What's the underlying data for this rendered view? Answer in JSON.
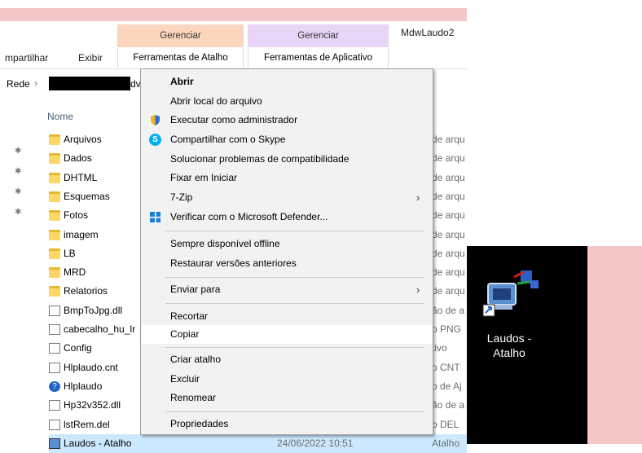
{
  "ribbon": {
    "tabs": [
      "mpartilhar",
      "Exibir"
    ],
    "ctx_groups": [
      {
        "header": "Gerenciar",
        "label": "Ferramentas de Atalho",
        "color": "#fcd5bd"
      },
      {
        "header": "Gerenciar",
        "label": "Ferramentas de Aplicativo",
        "color": "#e8d5f7"
      }
    ],
    "window_title": "MdwLaudo2"
  },
  "address": {
    "root": "Rede",
    "sep": "›",
    "partial": "dv"
  },
  "list": {
    "header": "Nome",
    "items": [
      {
        "name": "Arquivos",
        "type": "de arqu",
        "kind": "folder"
      },
      {
        "name": "Dados",
        "type": "de arqu",
        "kind": "folder"
      },
      {
        "name": "DHTML",
        "type": "de arqu",
        "kind": "folder"
      },
      {
        "name": "Esquemas",
        "type": "de arqu",
        "kind": "folder"
      },
      {
        "name": "Fotos",
        "type": "de arqu",
        "kind": "folder"
      },
      {
        "name": "imagem",
        "type": "de arqu",
        "kind": "folder"
      },
      {
        "name": "LB",
        "type": "de arqu",
        "kind": "folder"
      },
      {
        "name": "MRD",
        "type": "de arqu",
        "kind": "folder"
      },
      {
        "name": "Relatorios",
        "type": "de arqu",
        "kind": "folder"
      },
      {
        "name": "BmpToJpg.dll",
        "type": "ão de a",
        "kind": "file"
      },
      {
        "name": "cabecalho_hu_lr",
        "type": "o PNG",
        "kind": "file"
      },
      {
        "name": "Config",
        "type": "tivo",
        "kind": "file"
      },
      {
        "name": "Hlplaudo.cnt",
        "type": "o CNT",
        "kind": "file"
      },
      {
        "name": "Hlplaudo",
        "type": "o de Aj",
        "kind": "help"
      },
      {
        "name": "Hp32v352.dll",
        "type": "ão de a",
        "kind": "file"
      },
      {
        "name": "lstRem.del",
        "type": "o DEL",
        "kind": "file"
      },
      {
        "name": "Laudos - Atalho",
        "type": "Atalho",
        "kind": "shortcut"
      }
    ],
    "last_date": "24/06/2022 10:51"
  },
  "context_menu": {
    "items": [
      {
        "label": "Abrir",
        "bold": true
      },
      {
        "label": "Abrir local do arquivo"
      },
      {
        "label": "Executar como administrador",
        "icon": "shield-icon"
      },
      {
        "label": "Compartilhar com o Skype",
        "icon": "skype-icon"
      },
      {
        "label": "Solucionar problemas de compatibilidade"
      },
      {
        "label": "Fixar em Iniciar"
      },
      {
        "label": "7-Zip",
        "submenu": true
      },
      {
        "label": "Verificar com o Microsoft Defender...",
        "icon": "defender-icon"
      },
      {
        "label": "Sempre disponível offline"
      },
      {
        "label": "Restaurar versões anteriores"
      },
      {
        "label": "Enviar para",
        "submenu": true
      },
      {
        "label": "Recortar"
      },
      {
        "label": "Copiar",
        "highlighted": true
      },
      {
        "label": "Criar atalho"
      },
      {
        "label": "Excluir"
      },
      {
        "label": "Renomear"
      },
      {
        "label": "Propriedades"
      }
    ]
  },
  "desktop_icon": {
    "label": "Laudos - Atalho"
  }
}
